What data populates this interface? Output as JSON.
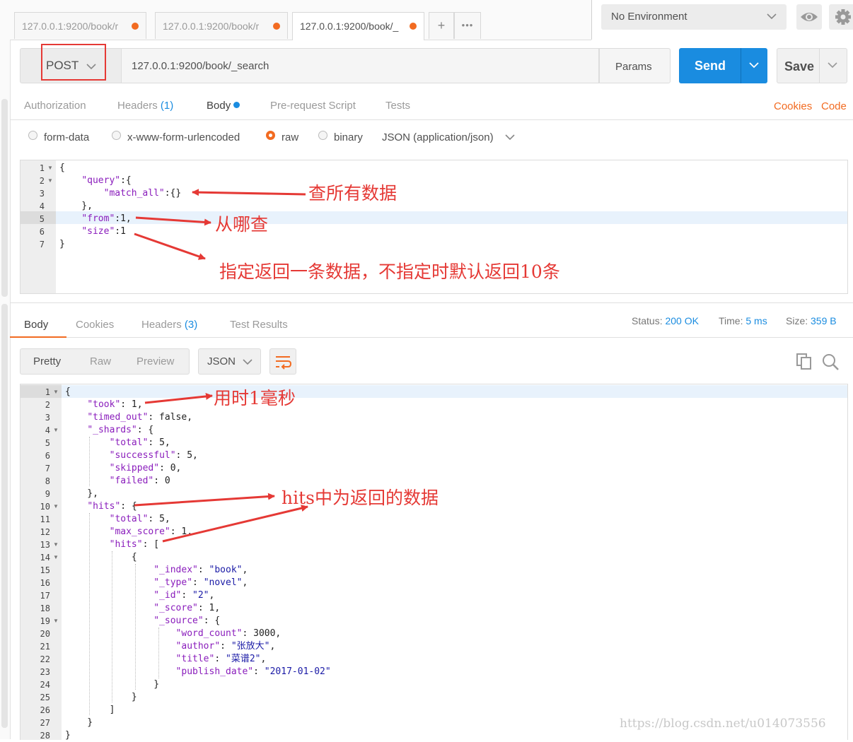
{
  "tabs": [
    {
      "label": "127.0.0.1:9200/book/r",
      "active": false
    },
    {
      "label": "127.0.0.1:9200/book/r",
      "active": false
    },
    {
      "label": "127.0.0.1:9200/book/_",
      "active": true
    }
  ],
  "tab_actions": {
    "add": "+",
    "more": "•••"
  },
  "environment": {
    "selected": "No Environment"
  },
  "request": {
    "method": "POST",
    "url": "127.0.0.1:9200/book/_search",
    "params_label": "Params",
    "send_label": "Send",
    "save_label": "Save"
  },
  "request_tabs": {
    "authorization": "Authorization",
    "headers": "Headers",
    "headers_count": "(1)",
    "body": "Body",
    "prerequest": "Pre-request Script",
    "tests": "Tests",
    "cookies": "Cookies",
    "code": "Code"
  },
  "body_types": {
    "form_data": "form-data",
    "urlencoded": "x-www-form-urlencoded",
    "raw": "raw",
    "binary": "binary",
    "content_type": "JSON (application/json)",
    "selected": "raw"
  },
  "request_body": {
    "line_numbers": [
      "1",
      "2",
      "3",
      "4",
      "5",
      "6",
      "7"
    ]
  },
  "response": {
    "tabs": {
      "body": "Body",
      "cookies": "Cookies",
      "headers": "Headers",
      "headers_count": "(3)",
      "test_results": "Test Results"
    },
    "status_label": "Status:",
    "status_value": "200 OK",
    "time_label": "Time:",
    "time_value": "5 ms",
    "size_label": "Size:",
    "size_value": "359 B",
    "view_modes": {
      "pretty": "Pretty",
      "raw": "Raw",
      "preview": "Preview"
    },
    "format": "JSON",
    "line_numbers": [
      "1",
      "2",
      "3",
      "4",
      "5",
      "6",
      "7",
      "8",
      "9",
      "10",
      "11",
      "12",
      "13",
      "14",
      "15",
      "16",
      "17",
      "18",
      "19",
      "20",
      "21",
      "22",
      "23",
      "24",
      "25",
      "26",
      "27",
      "28"
    ]
  },
  "annotations": {
    "match_all": "查所有数据",
    "from": "从哪查",
    "size": "指定返回一条数据，不指定时默认返回10条",
    "took": "用时1毫秒",
    "hits": "hits中为返回的数据"
  },
  "watermark": "https://blog.csdn.net/u014073556",
  "colors": {
    "accent": "#f26b21",
    "primary": "#1a8ce0",
    "annotation": "#e53935"
  }
}
